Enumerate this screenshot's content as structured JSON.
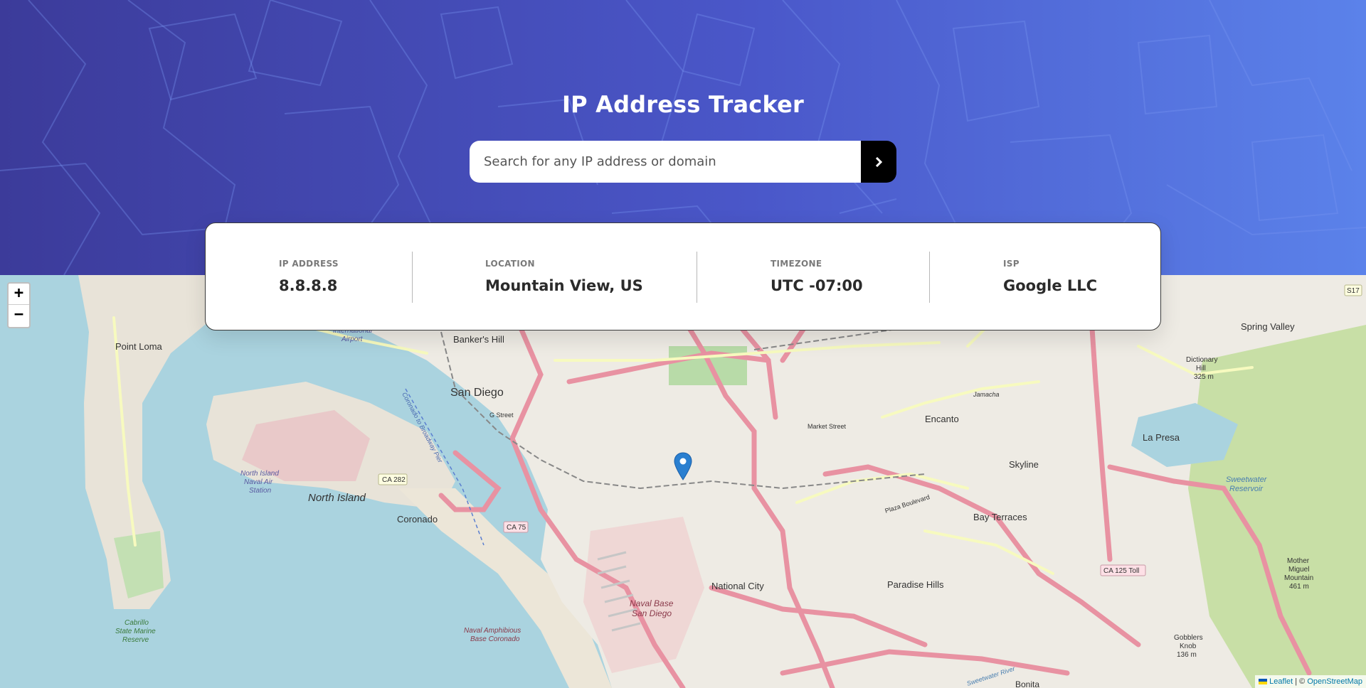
{
  "header": {
    "title": "IP Address Tracker"
  },
  "search": {
    "placeholder": "Search for any IP address or domain",
    "value": "",
    "button_icon": "chevron-right-icon"
  },
  "info": {
    "ip": {
      "label": "IP ADDRESS",
      "value": "8.8.8.8"
    },
    "location": {
      "label": "LOCATION",
      "value": "Mountain View, US"
    },
    "timezone": {
      "label": "TIMEZONE",
      "value": "UTC -07:00"
    },
    "isp": {
      "label": "ISP",
      "value": "Google LLC"
    }
  },
  "map": {
    "zoom_in": "+",
    "zoom_out": "−",
    "marker_icon": "map-pin-icon",
    "attribution": {
      "leaflet": "Leaflet",
      "separator": " | © ",
      "osm": "OpenStreetMap"
    },
    "labels": {
      "point_loma": "Point Loma",
      "bankers_hill": "Banker's Hill",
      "san_diego": "San Diego",
      "north_island": "North Island",
      "coronado": "Coronado",
      "national_city": "National City",
      "naval_base": "Naval Base",
      "naval_base_2": "San Diego",
      "encanto": "Encanto",
      "skyline": "Skyline",
      "bay_terraces": "Bay Terraces",
      "paradise_hills": "Paradise Hills",
      "la_presa": "La Presa",
      "spring_valley": "Spring Valley",
      "dictionary_hill": "Dictionary",
      "dictionary_hill_2": "Hill",
      "dictionary_hill_3": "325 m",
      "sweetwater": "Sweetwater",
      "sweetwater_2": "Reservoir",
      "mother_miguel": "Mother",
      "mother_miguel_2": "Miguel",
      "mother_miguel_3": "Mountain",
      "mother_miguel_4": "461 m",
      "gobblers": "Gobblers",
      "gobblers_2": "Knob",
      "gobblers_3": "136 m",
      "bonita": "Bonita",
      "cabrillo": "Cabrillo",
      "cabrillo_2": "State Marine",
      "cabrillo_3": "Reserve",
      "airport": "International",
      "airport_2": "Airport",
      "nas": "North Island",
      "nas_2": "Naval Air",
      "nas_3": "Station",
      "amphib": "Naval Amphibious",
      "amphib_2": "Base Coronado",
      "ca282": "CA 282",
      "ca75": "CA 75",
      "ca125": "CA 125 Toll",
      "s17": "S17",
      "market_street": "Market Street",
      "plaza_boulevard": "Plaza Boulevard",
      "g_street": "G Street",
      "jamacha": "Jamacha",
      "sweetwater_river": "Sweetwater River",
      "coronado_ferry": "Coronado to Broadway Pier"
    }
  }
}
